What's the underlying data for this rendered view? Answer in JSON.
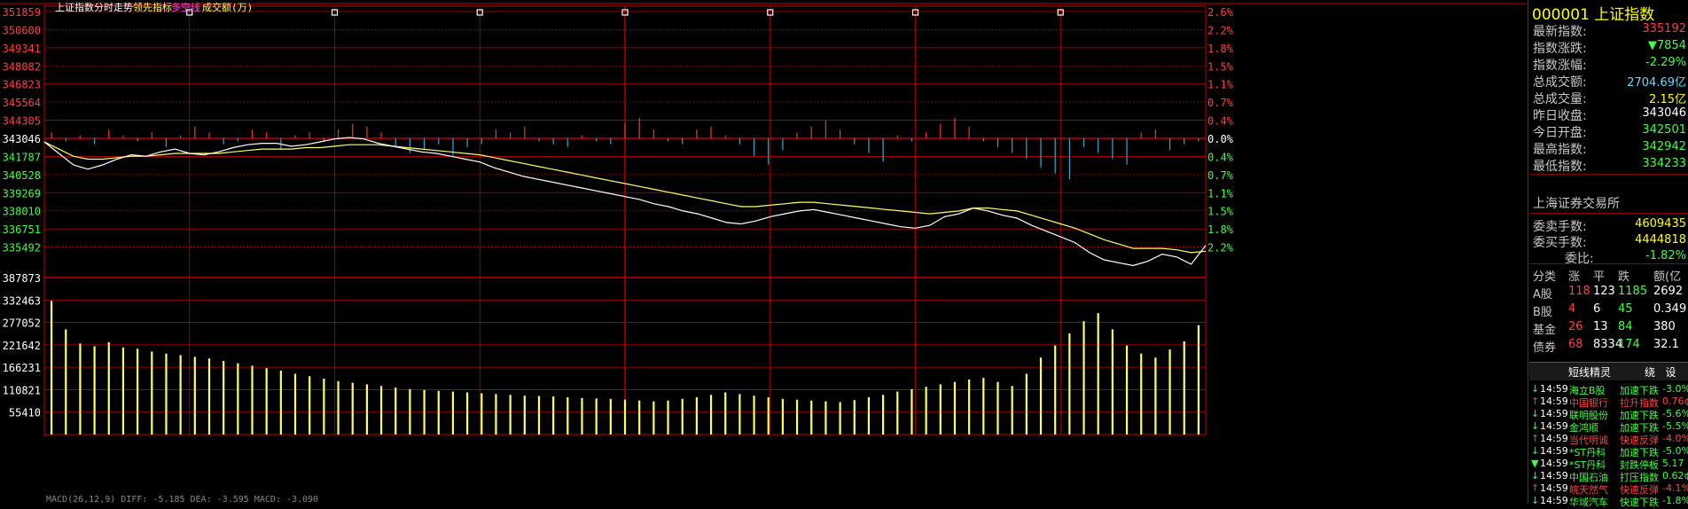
{
  "header": {
    "title": "上证指数分时走势",
    "ind1": "领先指标",
    "ind2": "多空线",
    "ind3": "成交额(万)",
    "bottom_label": "MACD(26,12,9) DIFF: -5.185 DEA: -3.595 MACD: -3.090"
  },
  "colors": {
    "up": "#ff4040",
    "down": "#40ff40",
    "axis": "#c00000",
    "price": "#ffffff",
    "avg": "#ffff60",
    "bar_up": "#ff3030",
    "bar_down": "#33aacc",
    "volume": "#ffff60"
  },
  "chart_data": {
    "type": "line",
    "price_axis": {
      "ticks": [
        "351859",
        "350600",
        "349341",
        "348082",
        "346823",
        "345564",
        "344305",
        "343046",
        "341787",
        "340528",
        "339269",
        "338010",
        "336751",
        "335492"
      ],
      "prev_close": 3430.46
    },
    "pct_axis": {
      "ticks": [
        "2.6%",
        "2.2%",
        "1.8%",
        "1.5%",
        "1.1%",
        "0.7%",
        "0.4%",
        "0.0%",
        "0.4%",
        "0.7%",
        "1.1%",
        "1.5%",
        "1.8%",
        "2.2%"
      ]
    },
    "volume_axis": {
      "ticks": [
        "387873",
        "332463",
        "277052",
        "221642",
        "166231",
        "110821",
        "55410"
      ],
      "ylim": [
        0,
        387873
      ]
    },
    "price": [
      3428,
      3420,
      3412,
      3409,
      3412,
      3416,
      3419,
      3418,
      3421,
      3423,
      3420,
      3419,
      3421,
      3424,
      3426,
      3427,
      3427,
      3425,
      3426,
      3428,
      3430,
      3431,
      3430,
      3427,
      3425,
      3423,
      3421,
      3420,
      3418,
      3416,
      3414,
      3410,
      3407,
      3404,
      3402,
      3400,
      3398,
      3396,
      3394,
      3392,
      3390,
      3388,
      3385,
      3383,
      3380,
      3378,
      3375,
      3372,
      3371,
      3373,
      3376,
      3378,
      3380,
      3381,
      3379,
      3377,
      3375,
      3373,
      3371,
      3369,
      3368,
      3370,
      3376,
      3378,
      3382,
      3380,
      3377,
      3375,
      3370,
      3366,
      3362,
      3358,
      3351,
      3346,
      3344,
      3342,
      3345,
      3350,
      3348,
      3343,
      3356
    ],
    "avg": [
      3428,
      3423,
      3418,
      3416,
      3416,
      3417,
      3418,
      3418,
      3419,
      3420,
      3420,
      3420,
      3420,
      3421,
      3422,
      3423,
      3423,
      3423,
      3424,
      3424,
      3425,
      3426,
      3426,
      3426,
      3425,
      3424,
      3423,
      3422,
      3421,
      3420,
      3419,
      3417,
      3415,
      3413,
      3411,
      3409,
      3407,
      3405,
      3403,
      3401,
      3399,
      3397,
      3395,
      3393,
      3391,
      3389,
      3387,
      3385,
      3383,
      3383,
      3384,
      3385,
      3386,
      3386,
      3385,
      3384,
      3383,
      3382,
      3381,
      3380,
      3379,
      3378,
      3379,
      3380,
      3382,
      3382,
      3381,
      3380,
      3377,
      3374,
      3371,
      3368,
      3364,
      3360,
      3357,
      3354,
      3354,
      3354,
      3353,
      3351,
      3352
    ],
    "lead_bars": [
      2,
      -1,
      1,
      -2,
      3,
      1,
      -1,
      2,
      -3,
      1,
      4,
      2,
      -2,
      -1,
      3,
      2,
      -4,
      1,
      2,
      -1,
      3,
      5,
      4,
      2,
      -3,
      -5,
      -4,
      -2,
      -6,
      -3,
      -2,
      3,
      2,
      4,
      -1,
      -2,
      -3,
      1,
      -1,
      -2,
      5,
      7,
      3,
      -1,
      -2,
      3,
      4,
      1,
      -2,
      -6,
      -9,
      -4,
      2,
      4,
      6,
      3,
      -2,
      -5,
      -8,
      1,
      -1,
      2,
      5,
      7,
      4,
      -1,
      -3,
      -5,
      -7,
      -10,
      -12,
      -14,
      -3,
      -5,
      -7,
      -9,
      2,
      3,
      -4,
      -2,
      -1
    ],
    "volume": [
      330000,
      260000,
      225000,
      218000,
      228000,
      215000,
      212000,
      205000,
      200000,
      196000,
      192000,
      188000,
      182000,
      176000,
      170000,
      164000,
      158000,
      150000,
      144000,
      138000,
      132000,
      128000,
      124000,
      120000,
      116000,
      112000,
      110000,
      108000,
      106000,
      104000,
      102000,
      100000,
      98000,
      96000,
      95000,
      94000,
      92000,
      90000,
      89000,
      88000,
      86000,
      84000,
      82000,
      84000,
      88000,
      92000,
      98000,
      104000,
      100000,
      96000,
      92000,
      88000,
      86000,
      84000,
      82000,
      80000,
      85000,
      92000,
      98000,
      106000,
      112000,
      118000,
      124000,
      130000,
      136000,
      140000,
      130000,
      120000,
      150000,
      190000,
      220000,
      250000,
      280000,
      300000,
      260000,
      220000,
      200000,
      190000,
      210000,
      230000,
      270000
    ]
  },
  "quote": {
    "code_name": "000001 上证指数",
    "rows": [
      {
        "label": "最新指数:",
        "value": "335192",
        "color": "up_text"
      },
      {
        "label": "指数涨跌:",
        "value": "▼7854",
        "color": "down"
      },
      {
        "label": "指数涨幅:",
        "value": "-2.29%",
        "color": "down"
      },
      {
        "label": "总成交额:",
        "value": "2704.69亿",
        "color": "cyan"
      },
      {
        "label": "总成交量:",
        "value": "2.15亿",
        "color": "yellow"
      },
      {
        "label": "昨日收盘:",
        "value": "343046",
        "color": "white"
      },
      {
        "label": "今日开盘:",
        "value": "342501",
        "color": "down"
      },
      {
        "label": "最高指数:",
        "value": "342942",
        "color": "down"
      },
      {
        "label": "最低指数:",
        "value": "334233",
        "color": "down"
      }
    ],
    "exchange": "上海证券交易所",
    "commission": [
      {
        "label": "委卖手数:",
        "value": "4609435",
        "color": "yellow"
      },
      {
        "label": "委买手数:",
        "value": "4444818",
        "color": "yellow"
      },
      {
        "label": "委比:",
        "value": "-1.82%",
        "color": "down"
      }
    ]
  },
  "breadth": {
    "header": [
      "分类",
      "涨",
      "平",
      "跌",
      "额(亿"
    ],
    "rows": [
      [
        "A股",
        "118",
        "123",
        "1185",
        "2692"
      ],
      [
        "B股",
        "4",
        "6",
        "45",
        "0.349"
      ],
      [
        "基金",
        "26",
        "13",
        "84",
        "380"
      ],
      [
        "债券",
        "68",
        "8334",
        "174",
        "32.1"
      ]
    ]
  },
  "alerts": {
    "title": "短线精灵",
    "btn1": "绕",
    "btn2": "设",
    "items": [
      {
        "arrow": "↓",
        "time": "14:59",
        "name": "海立B股",
        "type": "加速下跌",
        "val": "-3.0%"
      },
      {
        "arrow": "↑",
        "time": "14:59",
        "name": "中国银行",
        "type": "拉升指数",
        "val": "0.76¢"
      },
      {
        "arrow": "↓",
        "time": "14:59",
        "name": "联明股份",
        "type": "加速下跌",
        "val": "-5.6%"
      },
      {
        "arrow": "↓",
        "time": "14:59",
        "name": "金鸿顺",
        "type": "加速下跌",
        "val": "-5.5%"
      },
      {
        "arrow": "↑",
        "time": "14:59",
        "name": "当代明诚",
        "type": "快速反弹",
        "val": "-4.0%"
      },
      {
        "arrow": "↓",
        "time": "14:59",
        "name": "*ST丹科",
        "type": "加速下跌",
        "val": "-5.0%"
      },
      {
        "arrow": "▼",
        "time": "14:59",
        "name": "*ST丹科",
        "type": "封跌停板",
        "val": "5.17"
      },
      {
        "arrow": "↓",
        "time": "14:59",
        "name": "中国石油",
        "type": "打压指数",
        "val": "0.62¢"
      },
      {
        "arrow": "↑",
        "time": "14:59",
        "name": "皖天然气",
        "type": "快速反弹",
        "val": "-4.1%"
      },
      {
        "arrow": "↓",
        "time": "14:59",
        "name": "华域汽车",
        "type": "快速下跌",
        "val": "-1.8%"
      }
    ]
  }
}
